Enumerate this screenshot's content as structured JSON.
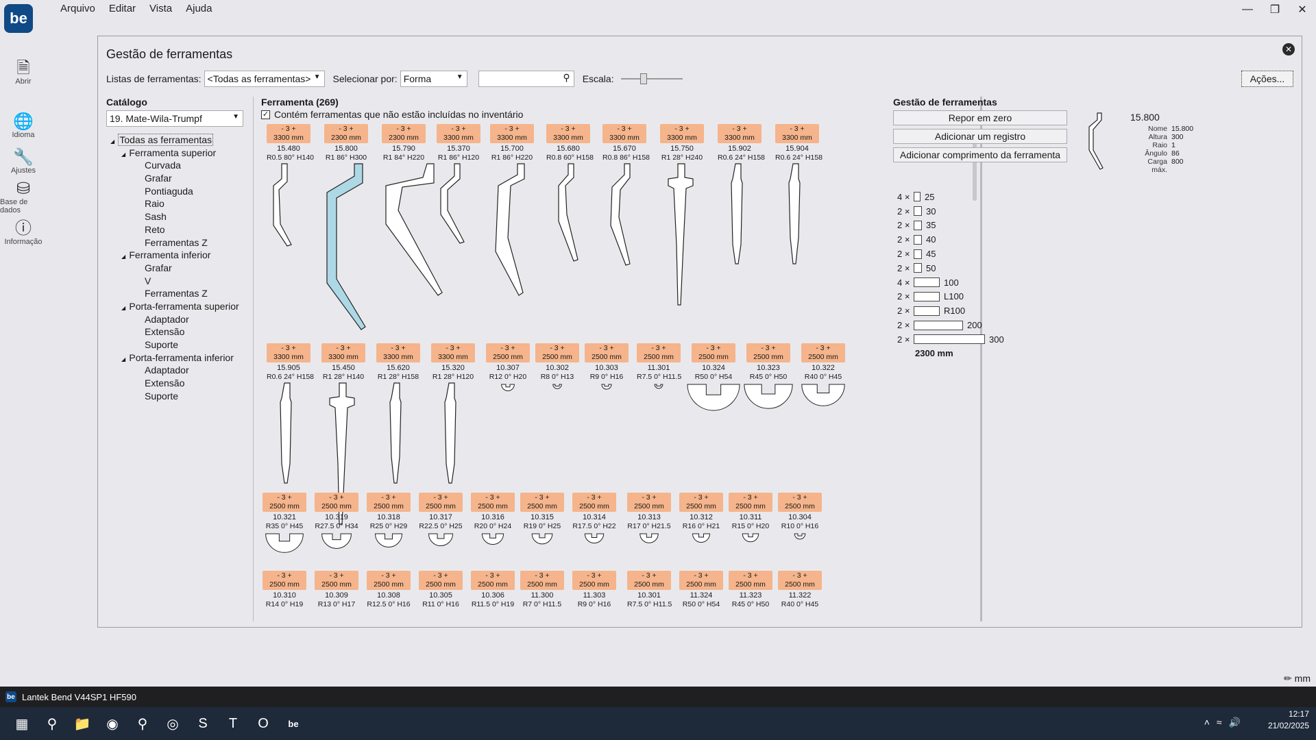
{
  "app": {
    "logo": "be",
    "taskbar_title": "Lantek Bend V44SP1 HF590",
    "unit": "mm"
  },
  "menu": [
    "Arquivo",
    "Editar",
    "Vista",
    "Ajuda"
  ],
  "leftnav": [
    {
      "label": "Abrir",
      "icon": "document-icon"
    },
    {
      "label": "Idioma",
      "icon": "globe-icon"
    },
    {
      "label": "Ajustes",
      "icon": "wrench-icon"
    },
    {
      "label": "Base de dados",
      "icon": "database-icon"
    },
    {
      "label": "Informação",
      "icon": "info-icon"
    }
  ],
  "panel": {
    "title": "Gestão de ferramentas",
    "tool_lists_label": "Listas de ferramentas:",
    "tool_lists_value": "<Todas as ferramentas>",
    "select_by_label": "Selecionar por:",
    "select_by_value": "Forma",
    "search_value": "",
    "scale_label": "Escala:",
    "scale_value": 0.35,
    "actions_label": "Ações..."
  },
  "catalog": {
    "label": "Catálogo",
    "selected": "19. Mate-Wila-Trumpf",
    "tree": [
      {
        "t": "Todas as ferramentas",
        "lvl": 0
      },
      {
        "t": "Ferramenta superior",
        "lvl": 1
      },
      {
        "t": "Curvada",
        "lvl": 2
      },
      {
        "t": "Grafar",
        "lvl": 2
      },
      {
        "t": "Pontiaguda",
        "lvl": 2
      },
      {
        "t": "Raio",
        "lvl": 2
      },
      {
        "t": "Sash",
        "lvl": 2
      },
      {
        "t": "Reto",
        "lvl": 2
      },
      {
        "t": "Ferramentas Z",
        "lvl": 2
      },
      {
        "t": "Ferramenta inferior",
        "lvl": 1
      },
      {
        "t": "Grafar",
        "lvl": 2
      },
      {
        "t": "V",
        "lvl": 2
      },
      {
        "t": "Ferramentas Z",
        "lvl": 2
      },
      {
        "t": "Porta-ferramenta superior",
        "lvl": 1
      },
      {
        "t": "Adaptador",
        "lvl": 2
      },
      {
        "t": "Extensão",
        "lvl": 2
      },
      {
        "t": "Suporte",
        "lvl": 2
      },
      {
        "t": "Porta-ferramenta inferior",
        "lvl": 1
      },
      {
        "t": "Adaptador",
        "lvl": 2
      },
      {
        "t": "Extensão",
        "lvl": 2
      },
      {
        "t": "Suporte",
        "lvl": 2
      }
    ]
  },
  "tools": {
    "header": "Ferramenta (269)",
    "inventory_label": "Contém ferramentas que não estão incluídas no inventário",
    "rows": [
      [
        {
          "name": "15.480",
          "p": "R0.5  80°  H140",
          "len": "3300 mm"
        },
        {
          "name": "15.800",
          "p": "R1  86°  H300",
          "len": "2300 mm"
        },
        {
          "name": "15.790",
          "p": "R1  84°  H220",
          "len": "2300 mm"
        },
        {
          "name": "15.370",
          "p": "R1  86°  H120",
          "len": "3300 mm"
        },
        {
          "name": "15.700",
          "p": "R1  86°  H220",
          "len": "3300 mm"
        },
        {
          "name": "15.680",
          "p": "R0.8  60°  H158",
          "len": "3300 mm"
        },
        {
          "name": "15.670",
          "p": "R0.8  86°  H158",
          "len": "3300 mm"
        },
        {
          "name": "15.750",
          "p": "R1  28°  H240",
          "len": "3300 mm"
        },
        {
          "name": "15.902",
          "p": "R0.6  24°  H158",
          "len": "3300 mm"
        },
        {
          "name": "15.904",
          "p": "R0.6  24°  H158",
          "len": "3300 mm"
        }
      ],
      [
        {
          "name": "15.905",
          "p": "R0.6  24°  H158",
          "len": "3300 mm"
        },
        {
          "name": "15.450",
          "p": "R1  28°  H140",
          "len": "3300 mm"
        },
        {
          "name": "15.620",
          "p": "R1  28°  H158",
          "len": "3300 mm"
        },
        {
          "name": "15.320",
          "p": "R1  28°  H120",
          "len": "3300 mm"
        },
        {
          "name": "10.307",
          "p": "R12  0°  H20",
          "len": "2500 mm"
        },
        {
          "name": "10.302",
          "p": "R8  0°  H13",
          "len": "2500 mm"
        },
        {
          "name": "10.303",
          "p": "R9  0°  H16",
          "len": "2500 mm"
        },
        {
          "name": "11.301",
          "p": "R7.5  0°  H11.5",
          "len": "2500 mm"
        },
        {
          "name": "10.324",
          "p": "R50  0°  H54",
          "len": "2500 mm"
        },
        {
          "name": "10.323",
          "p": "R45  0°  H50",
          "len": "2500 mm"
        },
        {
          "name": "10.322",
          "p": "R40  0°  H45",
          "len": "2500 mm"
        }
      ],
      [
        {
          "name": "10.321",
          "p": "R35  0°  H45",
          "len": "2500 mm"
        },
        {
          "name": "10.319",
          "p": "R27.5  0°  H34",
          "len": "2500 mm"
        },
        {
          "name": "10.318",
          "p": "R25  0°  H29",
          "len": "2500 mm"
        },
        {
          "name": "10.317",
          "p": "R22.5  0°  H25",
          "len": "2500 mm"
        },
        {
          "name": "10.316",
          "p": "R20  0°  H24",
          "len": "2500 mm"
        },
        {
          "name": "10.315",
          "p": "R19  0°  H25",
          "len": "2500 mm"
        },
        {
          "name": "10.314",
          "p": "R17.5  0°  H22",
          "len": "2500 mm"
        },
        {
          "name": "10.313",
          "p": "R17  0°  H21.5",
          "len": "2500 mm"
        },
        {
          "name": "10.312",
          "p": "R16  0°  H21",
          "len": "2500 mm"
        },
        {
          "name": "10.311",
          "p": "R15  0°  H20",
          "len": "2500 mm"
        },
        {
          "name": "10.304",
          "p": "R10  0°  H16",
          "len": "2500 mm"
        }
      ],
      [
        {
          "name": "10.310",
          "p": "R14  0°  H19",
          "len": "2500 mm"
        },
        {
          "name": "10.309",
          "p": "R13  0°  H17",
          "len": "2500 mm"
        },
        {
          "name": "10.308",
          "p": "R12.5  0°  H16",
          "len": "2500 mm"
        },
        {
          "name": "10.305",
          "p": "R11  0°  H16",
          "len": "2500 mm"
        },
        {
          "name": "10.306",
          "p": "R11.5  0°  H19",
          "len": "2500 mm"
        },
        {
          "name": "11.300",
          "p": "R7  0°  H11.5",
          "len": "2500 mm"
        },
        {
          "name": "11.303",
          "p": "R9  0°  H16",
          "len": "2500 mm"
        },
        {
          "name": "10.301",
          "p": "R7.5  0°  H11.5",
          "len": "2500 mm"
        },
        {
          "name": "11.324",
          "p": "R50  0°  H54",
          "len": "2500 mm"
        },
        {
          "name": "11.323",
          "p": "R45  0°  H50",
          "len": "2500 mm"
        },
        {
          "name": "11.322",
          "p": "R40  0°  H45",
          "len": "2500 mm"
        }
      ]
    ],
    "qty_label": "- 3 +",
    "selected": "15.800"
  },
  "right": {
    "title": "Gestão de ferramentas",
    "buttons": [
      "Repor em zero",
      "Adicionar um registro",
      "Adicionar comprimento da ferramenta"
    ],
    "info": {
      "title": "15.800",
      "rows": [
        {
          "k": "Nome",
          "v": "15.800"
        },
        {
          "k": "Altura",
          "v": "300"
        },
        {
          "k": "Raio",
          "v": "1"
        },
        {
          "k": "Ângulo",
          "v": "86"
        },
        {
          "k": "Carga máx.",
          "v": "800"
        }
      ]
    },
    "segments": [
      {
        "q": "4 ×",
        "v": "25"
      },
      {
        "q": "2 ×",
        "v": "30"
      },
      {
        "q": "2 ×",
        "v": "35"
      },
      {
        "q": "2 ×",
        "v": "40"
      },
      {
        "q": "2 ×",
        "v": "45"
      },
      {
        "q": "2 ×",
        "v": "50"
      },
      {
        "q": "4 ×",
        "v": "100"
      },
      {
        "q": "2 ×",
        "v": "L100"
      },
      {
        "q": "2 ×",
        "v": "R100"
      },
      {
        "q": "2 ×",
        "v": "200"
      },
      {
        "q": "2 ×",
        "v": "300"
      }
    ],
    "total": "2300 mm"
  },
  "clock": {
    "time": "12:17",
    "date": "21/02/2025"
  },
  "colors": {
    "badge": "#f5b48b",
    "selected_tool": "#add8e6",
    "accent": "#0f4a86"
  }
}
